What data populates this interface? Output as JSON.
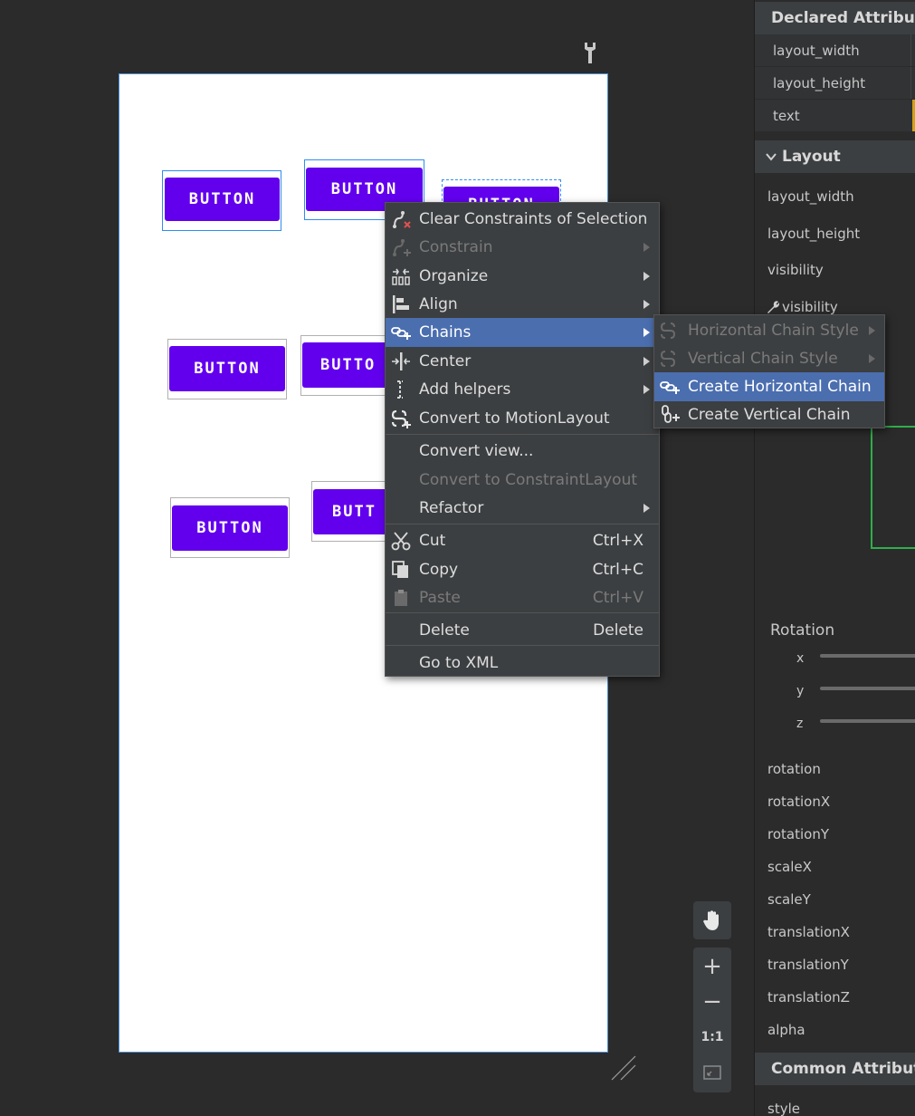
{
  "canvas": {
    "buttons": [
      {
        "label": "BUTTON"
      },
      {
        "label": "BUTTON"
      },
      {
        "label": "BUTTON"
      },
      {
        "label": "BUTTON"
      },
      {
        "label": "BUTTO"
      },
      {
        "label": "BUTTON"
      },
      {
        "label": "BUTT"
      }
    ],
    "zoom": {
      "pan_icon": "hand-icon",
      "zoom_in": "+",
      "zoom_out": "−",
      "actual_size": "1:1",
      "fit_icon": "fit-screen-icon"
    }
  },
  "context_menu": {
    "items": [
      {
        "label": "Clear Constraints of Selection",
        "icon": "clear-constraints-icon",
        "enabled": true
      },
      {
        "label": "Constrain",
        "icon": "constrain-icon",
        "enabled": false,
        "submenu": true
      },
      {
        "label": "Organize",
        "icon": "organize-icon",
        "enabled": true,
        "submenu": true
      },
      {
        "label": "Align",
        "icon": "align-icon",
        "enabled": true,
        "submenu": true
      },
      {
        "label": "Chains",
        "icon": "chains-icon",
        "enabled": true,
        "submenu": true,
        "highlighted": true
      },
      {
        "label": "Center",
        "icon": "center-icon",
        "enabled": true,
        "submenu": true
      },
      {
        "label": "Add helpers",
        "icon": "add-helpers-icon",
        "enabled": true,
        "submenu": true
      },
      {
        "label": "Convert to MotionLayout",
        "icon": "motionlayout-icon",
        "enabled": true
      },
      {
        "label": "Convert view...",
        "enabled": true
      },
      {
        "label": "Convert to ConstraintLayout",
        "enabled": false
      },
      {
        "label": "Refactor",
        "enabled": true,
        "submenu": true
      },
      {
        "label": "Cut",
        "icon": "cut-icon",
        "shortcut": "Ctrl+X",
        "enabled": true
      },
      {
        "label": "Copy",
        "icon": "copy-icon",
        "shortcut": "Ctrl+C",
        "enabled": true
      },
      {
        "label": "Paste",
        "icon": "paste-icon",
        "shortcut": "Ctrl+V",
        "enabled": false
      },
      {
        "label": "Delete",
        "shortcut": "Delete",
        "enabled": true
      },
      {
        "label": "Go to XML",
        "enabled": true
      }
    ]
  },
  "chains_submenu": {
    "items": [
      {
        "label": "Horizontal Chain Style",
        "enabled": false,
        "submenu": true
      },
      {
        "label": "Vertical Chain Style",
        "enabled": false,
        "submenu": true
      },
      {
        "label": "Create Horizontal Chain",
        "enabled": true,
        "highlighted": true
      },
      {
        "label": "Create Vertical Chain",
        "enabled": true
      }
    ]
  },
  "attributes": {
    "declared_title": "Declared Attributes",
    "declared_rows": [
      "layout_width",
      "layout_height",
      "text"
    ],
    "layout_title": "Layout",
    "layout_rows": [
      "layout_width",
      "layout_height",
      "visibility",
      "visibility"
    ],
    "rotation_title": "Rotation",
    "rotation_axes": [
      "x",
      "y",
      "z"
    ],
    "transform_rows": [
      "rotation",
      "rotationX",
      "rotationY",
      "scaleX",
      "scaleY",
      "translationX",
      "translationY",
      "translationZ",
      "alpha"
    ],
    "common_title": "Common Attributes",
    "common_rows": [
      "style"
    ]
  },
  "colors": {
    "accent_button": "#6200ee",
    "menu_highlight": "#4b6eaf",
    "selection_border": "#2f8cf0"
  }
}
